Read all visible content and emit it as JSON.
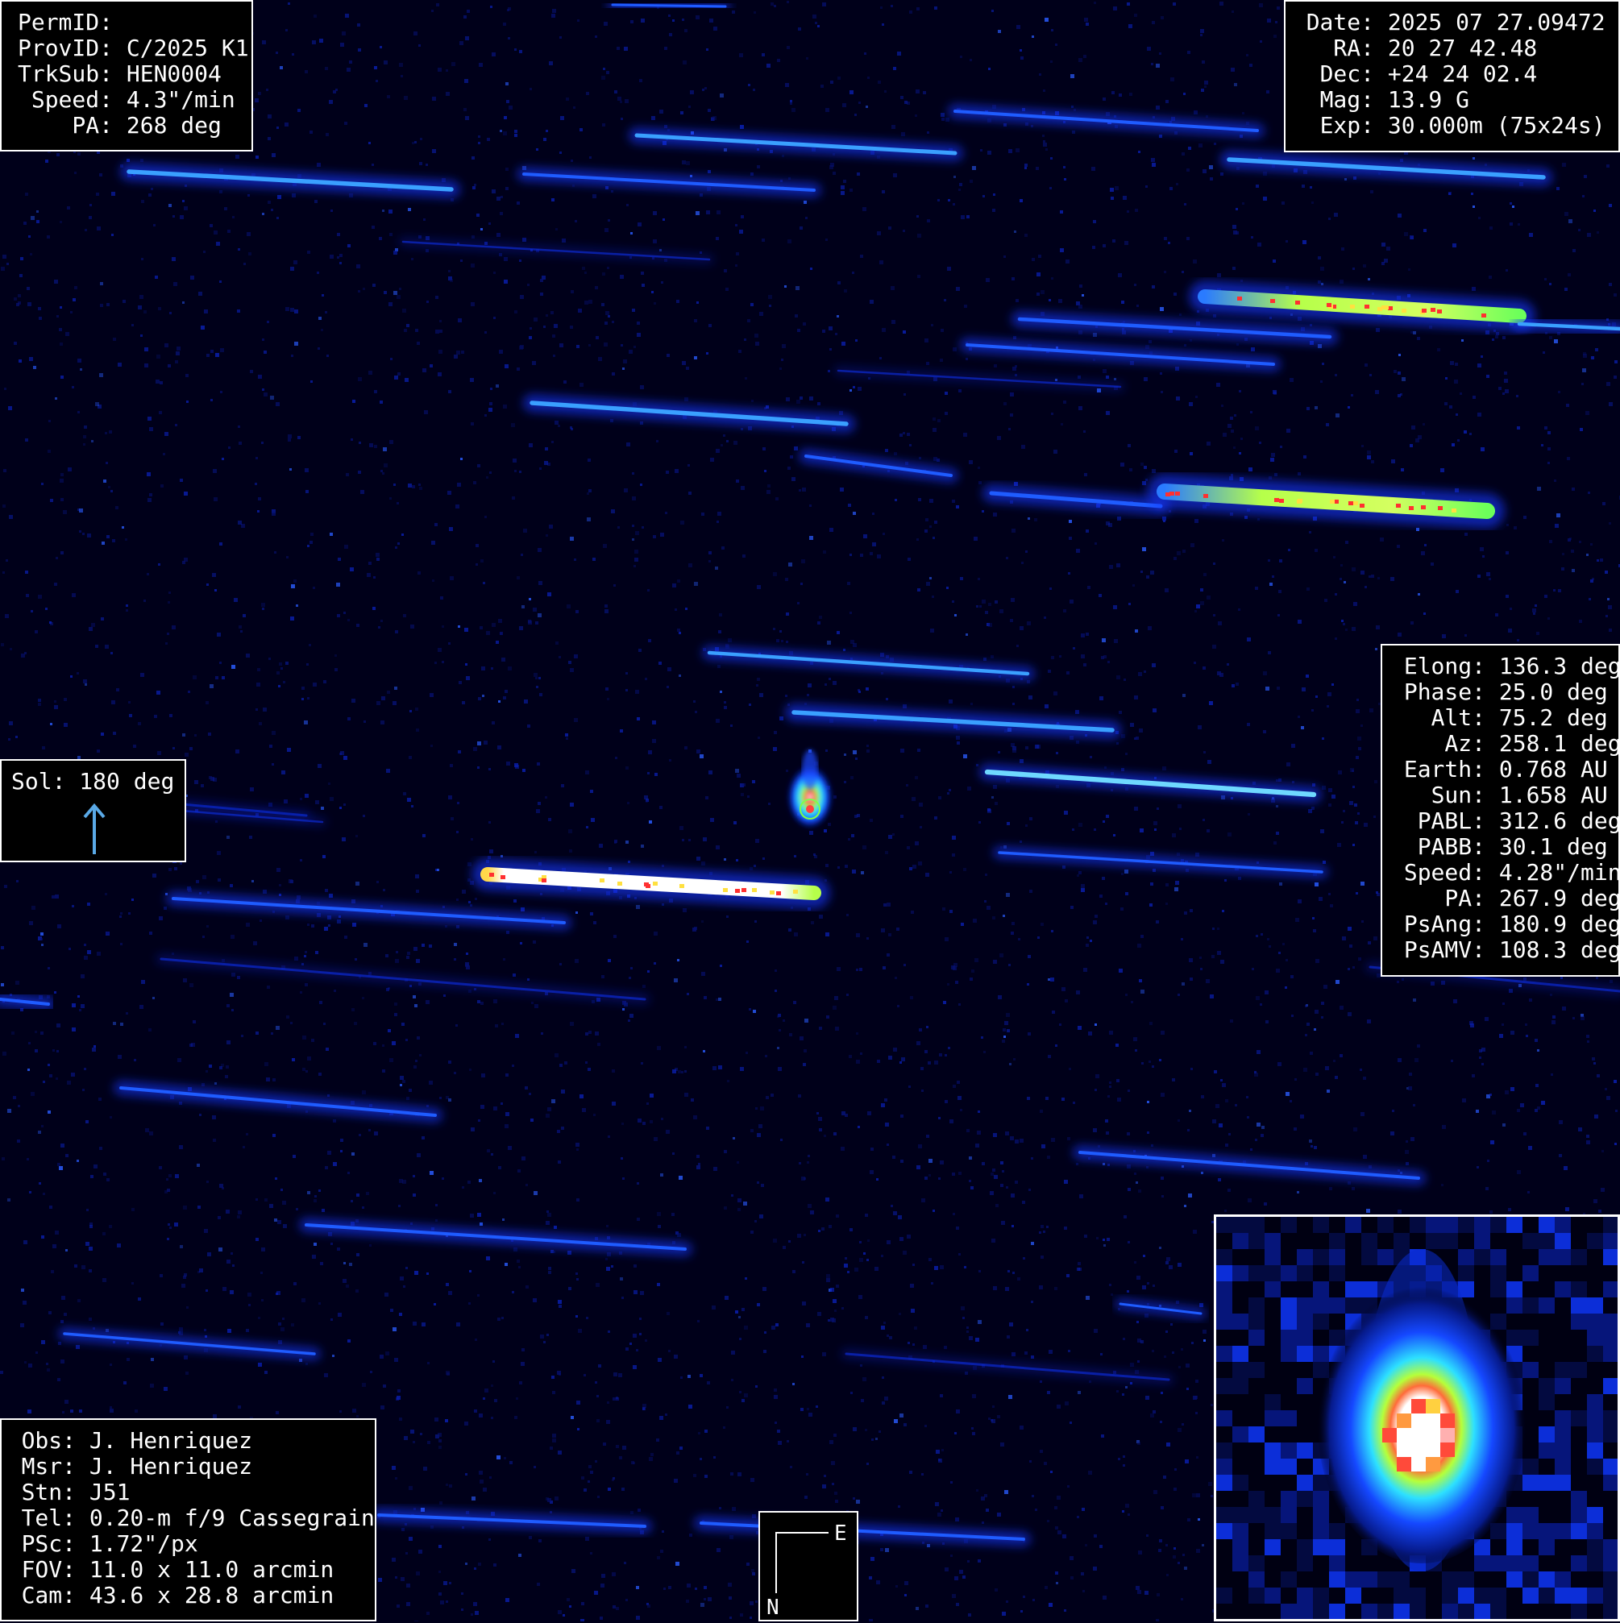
{
  "meta": {
    "perm_id_label": "PermID:",
    "perm_id_value": "",
    "prov_id_label": "ProvID:",
    "prov_id_value": "C/2025 K1",
    "trksub_label": "TrkSub:",
    "trksub_value": "HEN0004",
    "speed_label": "Speed:",
    "speed_value": "4.3\"/min",
    "pa_label": "PA:",
    "pa_value": "268 deg"
  },
  "observation": {
    "date_label": "Date:",
    "date_value": "2025 07 27.09472",
    "ra_label": "RA:",
    "ra_value": "20 27 42.48",
    "dec_label": "Dec:",
    "dec_value": "+24 24 02.4",
    "mag_label": "Mag:",
    "mag_value": "13.9 G",
    "exp_label": "Exp:",
    "exp_value": "30.000m (75x24s)"
  },
  "geometry": {
    "rows": [
      {
        "label": "Elong:",
        "value": "136.3 deg"
      },
      {
        "label": "Phase:",
        "value": "25.0 deg"
      },
      {
        "label": "Alt:",
        "value": "75.2 deg"
      },
      {
        "label": "Az:",
        "value": "258.1 deg"
      },
      {
        "label": "Earth:",
        "value": "0.768 AU"
      },
      {
        "label": "Sun:",
        "value": "1.658 AU"
      },
      {
        "label": "PABL:",
        "value": "312.6 deg"
      },
      {
        "label": "PABB:",
        "value": "30.1 deg"
      },
      {
        "label": "Speed:",
        "value": "4.28\"/min"
      },
      {
        "label": "PA:",
        "value": "267.9 deg"
      },
      {
        "label": "PsAng:",
        "value": "180.9 deg"
      },
      {
        "label": "PsAMV:",
        "value": "108.3 deg"
      }
    ]
  },
  "sol": {
    "label": "Sol:",
    "value": "180 deg",
    "arrow_color": "#5aa9e6",
    "arrow_icon": "up-arrow-icon"
  },
  "equipment": {
    "obs_label": "Obs:",
    "obs_value": "J. Henriquez",
    "msr_label": "Msr:",
    "msr_value": "J. Henriquez",
    "stn_label": "Stn:",
    "stn_value": "J51",
    "tel_label": "Tel:",
    "tel_value": "0.20-m f/9 Cassegrain",
    "psc_label": "PSc:",
    "psc_value": "1.72\"/px",
    "fov_label": "FOV:",
    "fov_value": "11.0 x 11.0 arcmin",
    "cam_label": "Cam:",
    "cam_value": "43.6 x 28.8 arcmin"
  },
  "compass": {
    "east_label": "E",
    "north_label": "N"
  },
  "colors": {
    "background": "#00001a",
    "streak": "#1a3cff",
    "streak_bright": "#ffffff",
    "core_green": "#7dff4a",
    "core_red": "#ff3030",
    "panel_border": "#ffffff"
  }
}
